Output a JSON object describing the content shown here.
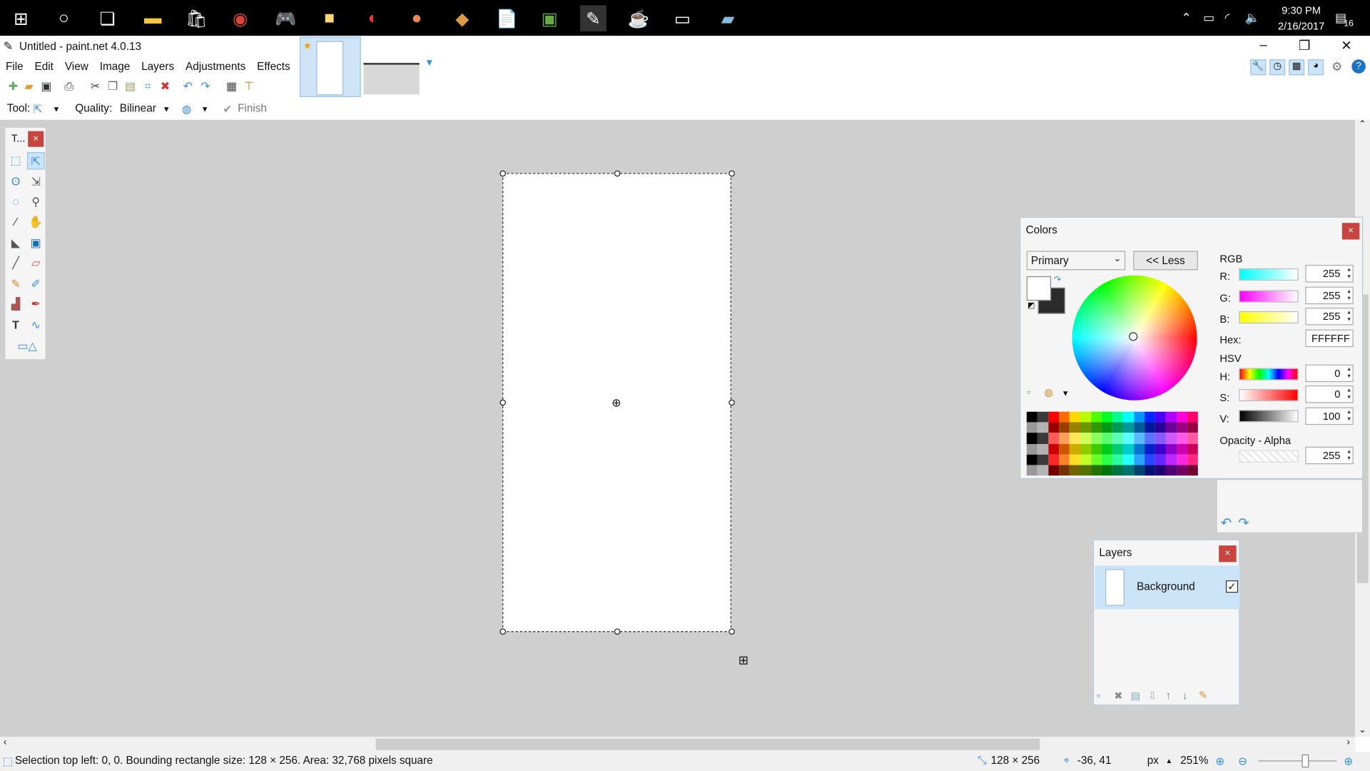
{
  "taskbar": {
    "time": "9:30 PM",
    "date": "2/16/2017",
    "notification_count": "16",
    "icons": [
      "windows-start-icon",
      "cortana-icon",
      "task-view-icon",
      "file-explorer-icon",
      "store-icon",
      "chrome-icon",
      "game-controller-icon",
      "sticky-notes-icon",
      "smash-icon",
      "game-icon",
      "package-icon",
      "document-icon",
      "image-viewer-icon",
      "paintnet-icon",
      "java-icon",
      "terminal-icon",
      "notepad-icon"
    ]
  },
  "window": {
    "title": "Untitled - paint.net 4.0.13",
    "minimize": "–",
    "restore": "❐",
    "close": "✕"
  },
  "menu": [
    "File",
    "Edit",
    "View",
    "Image",
    "Layers",
    "Adjustments",
    "Effects"
  ],
  "toolbar2": {
    "tool_label": "Tool:",
    "quality_label": "Quality:",
    "quality_value": "Bilinear",
    "finish_label": "Finish"
  },
  "tools_window": {
    "title": "T...",
    "close": "×"
  },
  "colors_window": {
    "title": "Colors",
    "close": "×",
    "mode": "Primary",
    "less_button": "<< Less",
    "rgb_label": "RGB",
    "r_label": "R:",
    "g_label": "G:",
    "b_label": "B:",
    "r": "255",
    "g": "255",
    "b": "255",
    "hex_label": "Hex:",
    "hex": "FFFFFF",
    "hsv_label": "HSV",
    "h_label": "H:",
    "s_label": "S:",
    "v_label": "V:",
    "h": "0",
    "s": "0",
    "v": "100",
    "opacity_label": "Opacity - Alpha",
    "alpha": "255",
    "palette_colors": [
      "#000000",
      "#404040",
      "#ff0000",
      "#ff6a00",
      "#ffd800",
      "#b6ff00",
      "#4cff00",
      "#00ff21",
      "#00ff90",
      "#00ffff",
      "#0094ff",
      "#0026ff",
      "#4800ff",
      "#b200ff",
      "#ff00dc",
      "#ff006e"
    ]
  },
  "layers_window": {
    "title": "Layers",
    "close": "×",
    "layer_name": "Background",
    "visible": "✓"
  },
  "status": {
    "selection_info": "Selection top left: 0, 0. Bounding rectangle size: 128 × 256. Area: 32,768 pixels square",
    "size": "128 × 256",
    "cursor": "-36, 41",
    "units": "px",
    "zoom": "251%"
  }
}
